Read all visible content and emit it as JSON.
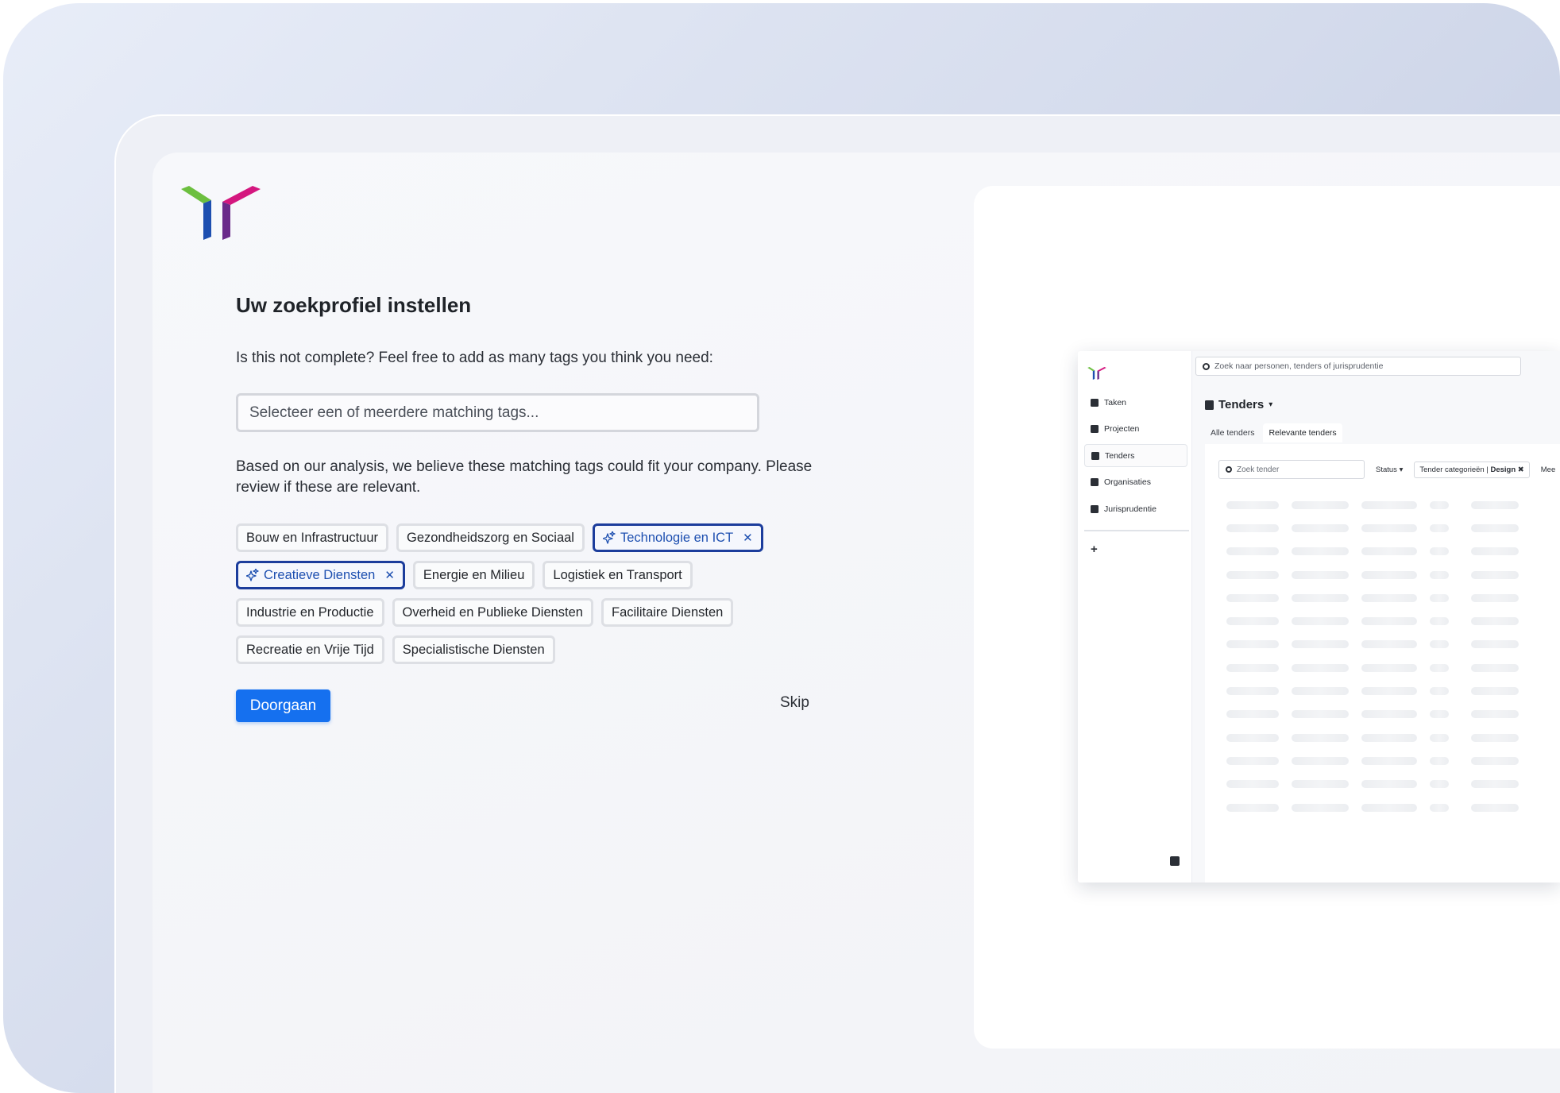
{
  "onboarding": {
    "title": "Uw zoekprofiel instellen",
    "subtitle": "Is this not complete? Feel free to add as many tags you think you need:",
    "tag_input_placeholder": "Selecteer een of meerdere matching tags...",
    "analysis_text": "Based on our analysis, we believe these matching tags could fit your company. Please review if these are relevant.",
    "tags": [
      {
        "label": "Bouw en Infrastructuur",
        "selected": false
      },
      {
        "label": "Gezondheidszorg en Sociaal",
        "selected": false
      },
      {
        "label": "Technologie en ICT",
        "selected": true
      },
      {
        "label": "Creatieve Diensten",
        "selected": true
      },
      {
        "label": "Energie en Milieu",
        "selected": false
      },
      {
        "label": "Logistiek en Transport",
        "selected": false
      },
      {
        "label": "Industrie en Productie",
        "selected": false
      },
      {
        "label": "Overheid en Publieke Diensten",
        "selected": false
      },
      {
        "label": "Facilitaire Diensten",
        "selected": false
      },
      {
        "label": "Recreatie en Vrije Tijd",
        "selected": false
      },
      {
        "label": "Specialistische Diensten",
        "selected": false
      }
    ],
    "remove_symbol": "✕",
    "continue_label": "Doorgaan",
    "skip_label": "Skip"
  },
  "preview": {
    "search_placeholder": "Zoek naar personen, tenders of jurisprudentie",
    "nav": [
      {
        "label": "Taken",
        "active": false
      },
      {
        "label": "Projecten",
        "active": false
      },
      {
        "label": "Tenders",
        "active": true
      },
      {
        "label": "Organisaties",
        "active": false
      },
      {
        "label": "Jurisprudentie",
        "active": false
      }
    ],
    "add_symbol": "+",
    "heading": "Tenders",
    "chevron": "▾",
    "tabs": [
      {
        "label": "Alle tenders",
        "active": false
      },
      {
        "label": "Relevante tenders",
        "active": true
      }
    ],
    "sub_search_placeholder": "Zoek tender",
    "status_label": "Status",
    "filter_chip_label": "Tender categorieën",
    "filter_chip_value": "Design",
    "filter_chip_remove": "✖",
    "more_label": "Mee"
  },
  "colors": {
    "primary": "#1570ef",
    "selected_border": "#1c3d9c",
    "selected_text": "#1d4fb0",
    "logo_green": "#6cbf3f",
    "logo_blue": "#1d4fb0",
    "logo_magenta": "#d4177f",
    "logo_purple": "#6a2a8a"
  }
}
